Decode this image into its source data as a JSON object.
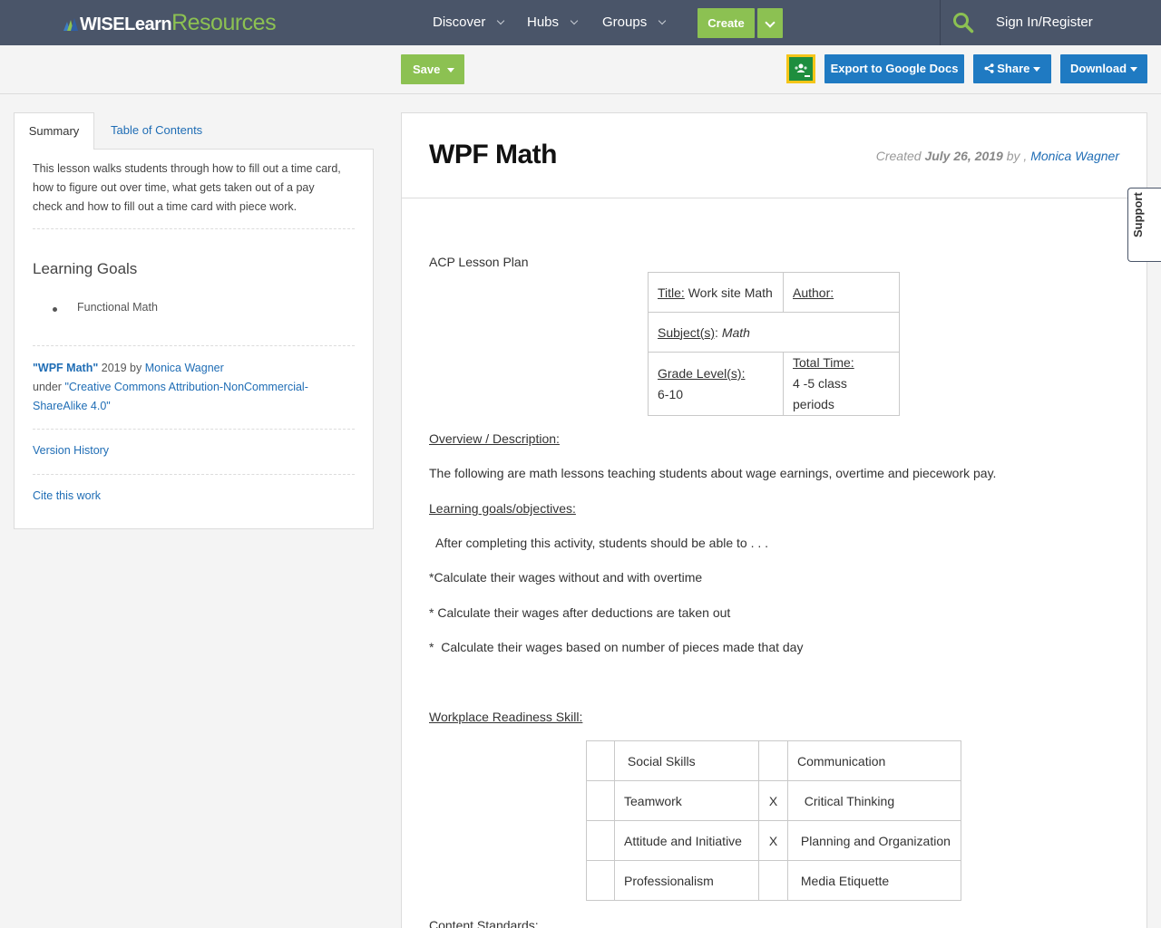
{
  "nav": {
    "logo_wise": "WISELearn",
    "logo_resources": "Resources",
    "discover": "Discover",
    "hubs": "Hubs",
    "groups": "Groups",
    "create": "Create",
    "signin": "Sign In/Register",
    "accent_color": "#8cc152",
    "bar_color": "#4a5569"
  },
  "toolbar": {
    "save": "Save",
    "export": "Export to Google Docs",
    "share": "Share",
    "download": "Download",
    "button_color": "#1f7ac2"
  },
  "sidebar": {
    "tab_summary": "Summary",
    "tab_toc": "Table of Contents",
    "description": "This lesson walks students through how to fill out a time card, how to figure out over time, what gets taken out of a pay check and how to fill out a time card with piece work.",
    "goals_heading": "Learning Goals",
    "goal_1": "Functional Math",
    "attr_title": "\"WPF Math\"",
    "attr_year": " 2019 by ",
    "attr_author": "Monica Wagner",
    "attr_under": "under ",
    "attr_license": "\"Creative Commons Attribution-NonCommercial-ShareAlike 4.0\"",
    "version_history": "Version History",
    "cite": "Cite this work"
  },
  "main": {
    "title": "WPF Math",
    "created_label": "Created ",
    "created_date": "July 26, 2019",
    "created_by": " by , ",
    "author": "Monica Wagner",
    "support": "Support",
    "plan_label": "ACP Lesson Plan",
    "info_table": {
      "title_label": "Title:",
      "title_value": " Work site Math",
      "author_label": "Author: ",
      "subject_label": "Subject(s)",
      "subject_colon": ":  ",
      "subject_value": "Math",
      "grade_label": "Grade Level(s):",
      "grade_value": "6-10",
      "time_label": "Total Time:",
      "time_value": "4 -5 class periods"
    },
    "overview_label": "Overview / Description:",
    "overview_text": "The following are math lessons teaching students about wage earnings, overtime and piecework pay.",
    "goals_label": "Learning goals/objectives:",
    "goals_intro": "  After completing this activity, students should be able to . . .",
    "goal_1": "*Calculate their wages without and with overtime",
    "goal_2": "* Calculate their wages after deductions are taken out",
    "goal_3": "*  Calculate their wages based on number of pieces made that day",
    "skills_label": "Workplace Readiness Skill:",
    "skills": [
      {
        "mark_a": "",
        "skill_a": " Social Skills",
        "mark_b": "",
        "skill_b": "Communication"
      },
      {
        "mark_a": "",
        "skill_a": "Teamwork",
        "mark_b": "X",
        "skill_b": "  Critical Thinking"
      },
      {
        "mark_a": "",
        "skill_a": "Attitude and Initiative",
        "mark_b": "X",
        "skill_b": " Planning and Organization"
      },
      {
        "mark_a": "",
        "skill_a": "Professionalism",
        "mark_b": "",
        "skill_b": " Media Etiquette"
      }
    ],
    "standards_label": "Content Standards:"
  }
}
